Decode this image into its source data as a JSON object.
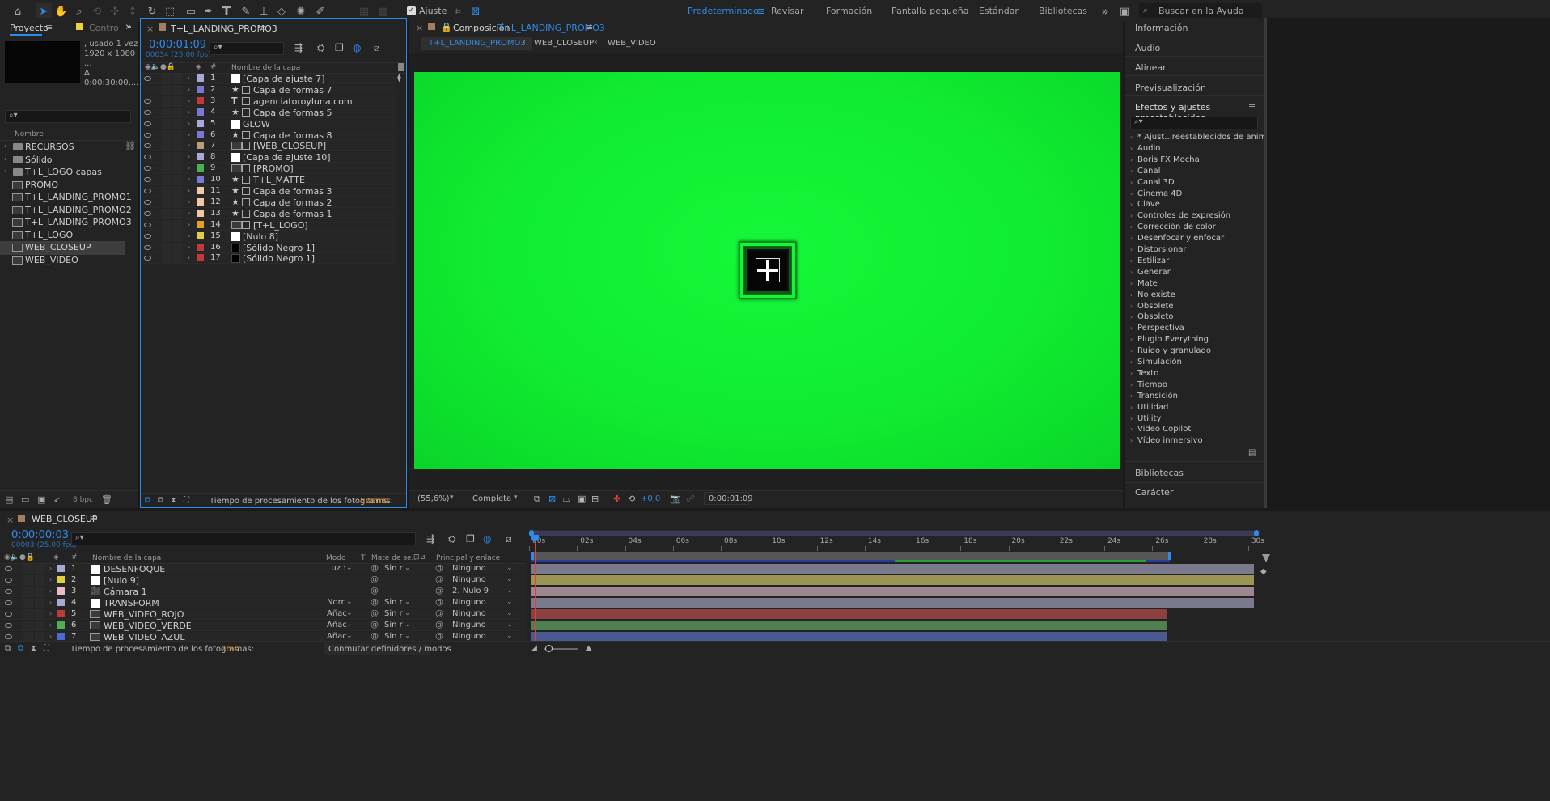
{
  "toolbar": {
    "snap_label": "Ajuste",
    "workspaces": [
      "Predeterminado",
      "Revisar",
      "Formación",
      "Pantalla pequeña",
      "Estándar",
      "Bibliotecas"
    ],
    "active_workspace": "Predeterminado",
    "search_placeholder": "Buscar en la Ayuda"
  },
  "project": {
    "tab": "Proyecto",
    "tab2": "Contro",
    "info_line1": ", usado 1 vez",
    "info_line2": "1920 x 1080 ...",
    "info_line3": "Δ 0:00:30:00,...",
    "col_name": "Nombre",
    "bpc": "8 bpc",
    "items": [
      {
        "label": "RECURSOS",
        "type": "folder"
      },
      {
        "label": "Sólido",
        "type": "folder"
      },
      {
        "label": "T+L_LOGO capas",
        "type": "folder"
      },
      {
        "label": "PROMO",
        "type": "comp"
      },
      {
        "label": "T+L_LANDING_PROMO1",
        "type": "comp"
      },
      {
        "label": "T+L_LANDING_PROMO2",
        "type": "comp"
      },
      {
        "label": "T+L_LANDING_PROMO3",
        "type": "comp"
      },
      {
        "label": "T+L_LOGO",
        "type": "comp"
      },
      {
        "label": "WEB_CLOSEUP",
        "type": "comp",
        "selected": true
      },
      {
        "label": "WEB_VIDEO",
        "type": "comp"
      }
    ]
  },
  "timeline_top": {
    "tab": "T+L_LANDING_PROMO3",
    "timecode": "0:00:01:09",
    "frame_info": "00034 (25.00 fps)",
    "col_num": "#",
    "col_name": "Nombre de la capa",
    "render_label": "Tiempo de procesamiento de los fotogramas:",
    "render_value": "521ms",
    "layers": [
      {
        "n": "1",
        "name": "[Capa de ajuste 7]",
        "color": "#a9a9d6",
        "kind": "white",
        "eye": true
      },
      {
        "n": "2",
        "name": "Capa de formas 7",
        "color": "#7a7ad6",
        "kind": "star",
        "eye": false
      },
      {
        "n": "3",
        "name": "agenciatoroyluna.com",
        "color": "#c03a3a",
        "kind": "text",
        "eye": true
      },
      {
        "n": "4",
        "name": "Capa de formas 5",
        "color": "#7a7ad6",
        "kind": "star",
        "eye": true
      },
      {
        "n": "5",
        "name": "GLOW",
        "color": "#a9a9d6",
        "kind": "white",
        "eye": true
      },
      {
        "n": "6",
        "name": "Capa de formas 8",
        "color": "#7a7ad6",
        "kind": "star",
        "eye": true
      },
      {
        "n": "7",
        "name": "[WEB_CLOSEUP]",
        "color": "#b8a07a",
        "kind": "comp",
        "eye": true
      },
      {
        "n": "8",
        "name": "[Capa de ajuste 10]",
        "color": "#a9a9d6",
        "kind": "white",
        "eye": true
      },
      {
        "n": "9",
        "name": "[PROMO]",
        "color": "#4caf50",
        "kind": "comp",
        "eye": true
      },
      {
        "n": "10",
        "name": "T+L_MATTE",
        "color": "#7a7ad6",
        "kind": "star",
        "eye": true
      },
      {
        "n": "11",
        "name": "Capa de formas 3",
        "color": "#f0c8a8",
        "kind": "star",
        "eye": true
      },
      {
        "n": "12",
        "name": "Capa de formas 2",
        "color": "#f0c8a8",
        "kind": "star",
        "eye": true
      },
      {
        "n": "13",
        "name": "Capa de formas 1",
        "color": "#f0c8a8",
        "kind": "star",
        "eye": true
      },
      {
        "n": "14",
        "name": "[T+L_LOGO]",
        "color": "#e8a020",
        "kind": "comp",
        "eye": true
      },
      {
        "n": "15",
        "name": "[Nulo 8]",
        "color": "#e0d040",
        "kind": "white",
        "eye": true
      },
      {
        "n": "16",
        "name": "[Sólido Negro 1]",
        "color": "#c03a3a",
        "kind": "black",
        "eye": true
      },
      {
        "n": "17",
        "name": "[Sólido Negro 1]",
        "color": "#c03a3a",
        "kind": "black",
        "eye": true
      }
    ]
  },
  "composition": {
    "tab_prefix": "Composición",
    "tab_name": "T+L_LANDING_PROMO3",
    "crumbs": [
      "T+L_LANDING_PROMO3",
      "WEB_CLOSEUP",
      "WEB_VIDEO"
    ],
    "zoom": "(55,6%)",
    "quality": "Completa",
    "exposure": "+0,0",
    "timecode": "0:00:01:09",
    "bg_color": "#12e834"
  },
  "right_panel": {
    "top_items": [
      "Información",
      "Audio",
      "Alinear",
      "Previsualización"
    ],
    "effects_title": "Efectos y ajustes preestablecidos",
    "effects": [
      "* Ajust...reestablecidos de animación",
      "Audio",
      "Boris FX Mocha",
      "Canal",
      "Canal 3D",
      "Cinema 4D",
      "Clave",
      "Controles de expresión",
      "Corrección de color",
      "Desenfocar y enfocar",
      "Distorsionar",
      "Estilizar",
      "Generar",
      "Mate",
      "No existe",
      "Obsolete",
      "Obsoleto",
      "Perspectiva",
      "Plugin Everything",
      "Ruido y granulado",
      "Simulación",
      "Texto",
      "Tiempo",
      "Transición",
      "Utilidad",
      "Utility",
      "Video Copilot",
      "Vídeo inmersivo"
    ],
    "bottom_items": [
      "Bibliotecas",
      "Carácter"
    ]
  },
  "timeline_bottom": {
    "tab": "WEB_CLOSEUP",
    "timecode": "0:00:00:03",
    "frame_info": "00003 (25.00 fps)",
    "col_num": "#",
    "col_name": "Nombre de la capa",
    "col_mode": "Modo",
    "col_t": "T",
    "col_matte": "Mate de se...",
    "col_parent": "Principal y enlace",
    "render_label": "Tiempo de procesamiento de los fotogramas:",
    "render_value": "2ms",
    "toggle_label": "Conmutar definidores / modos",
    "ruler": [
      "00s",
      "02s",
      "04s",
      "06s",
      "08s",
      "10s",
      "12s",
      "14s",
      "16s",
      "18s",
      "20s",
      "22s",
      "24s",
      "26s",
      "28s",
      "30s"
    ],
    "layers": [
      {
        "n": "1",
        "name": "DESENFOQUE",
        "color": "#a9a9d6",
        "mode": "Luz :",
        "matte": "Sin r",
        "parent": "Ninguno",
        "bar": "#7a7a8c",
        "bar_end": 1.0
      },
      {
        "n": "2",
        "name": "[Nulo 9]",
        "color": "#e0d040",
        "mode": "",
        "matte": "",
        "parent": "Ninguno",
        "bar": "#9a9455",
        "bar_end": 1.0
      },
      {
        "n": "3",
        "name": "Cámara 1",
        "color": "#f0b8c8",
        "mode": "",
        "matte": "",
        "parent": "2. Nulo 9",
        "bar": "#9c8690",
        "bar_end": 1.0
      },
      {
        "n": "4",
        "name": "TRANSFORM",
        "color": "#a9a9d6",
        "mode": "Norr",
        "matte": "Sin r",
        "parent": "Ninguno",
        "bar": "#7a7a8c",
        "bar_end": 1.0
      },
      {
        "n": "5",
        "name": "WEB_VIDEO_ROJO",
        "color": "#c03a3a",
        "mode": "Añac",
        "matte": "Sin r",
        "parent": "Ninguno",
        "bar": "#8c4040",
        "bar_end": 0.88
      },
      {
        "n": "6",
        "name": "WEB_VIDEO_VERDE",
        "color": "#4caf50",
        "mode": "Añac",
        "matte": "Sin r",
        "parent": "Ninguno",
        "bar": "#4f8050",
        "bar_end": 0.88
      },
      {
        "n": "7",
        "name": "WEB_VIDEO_AZUL",
        "color": "#4a6ad0",
        "mode": "Añac",
        "matte": "Sin r",
        "parent": "Ninguno",
        "bar": "#4a5a90",
        "bar_end": 0.88
      }
    ]
  }
}
